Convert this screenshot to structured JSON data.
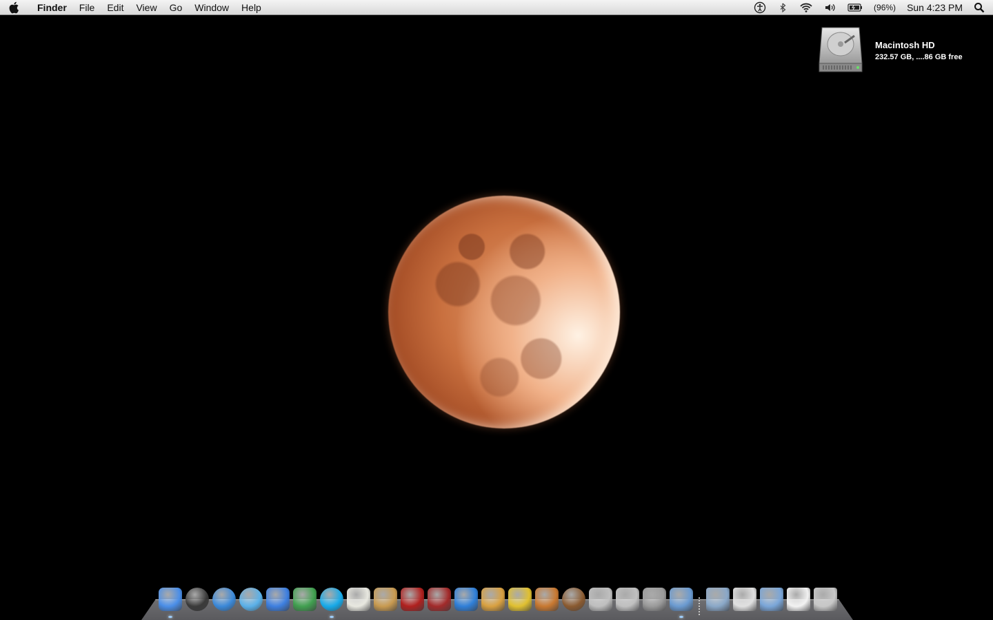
{
  "menubar": {
    "apple_icon": "apple-logo-icon",
    "app_name": "Finder",
    "menus": [
      "File",
      "Edit",
      "View",
      "Go",
      "Window",
      "Help"
    ],
    "status": {
      "accessibility_icon": "accessibility-icon",
      "bluetooth_icon": "bluetooth-icon",
      "wifi_icon": "wifi-icon",
      "volume_icon": "volume-icon",
      "battery_icon": "battery-icon",
      "battery_percent": "(96%)",
      "clock": "Sun 4:23 PM",
      "spotlight_icon": "spotlight-search-icon"
    }
  },
  "desktop": {
    "wallpaper": "lunar-eclipse-moon",
    "drive": {
      "name": "Macintosh HD",
      "info": "232.57 GB, ....86 GB free",
      "icon": "hard-drive-icon"
    }
  },
  "dock": {
    "apps": [
      {
        "name": "Finder",
        "icon": "finder-icon",
        "running": true,
        "color": "#4a8ee8"
      },
      {
        "name": "Dashboard",
        "icon": "dashboard-icon",
        "running": false,
        "color": "#3a3a3a"
      },
      {
        "name": "Safari",
        "icon": "safari-icon",
        "running": false,
        "color": "#3a88d8"
      },
      {
        "name": "iTunes",
        "icon": "itunes-icon",
        "running": false,
        "color": "#5ab0e8"
      },
      {
        "name": "iChat",
        "icon": "ichat-icon",
        "running": false,
        "color": "#3d7fe0"
      },
      {
        "name": "Messenger",
        "icon": "messenger-icon",
        "running": false,
        "color": "#41a050"
      },
      {
        "name": "Skype",
        "icon": "skype-icon",
        "running": true,
        "color": "#16a9e8"
      },
      {
        "name": "TextEdit",
        "icon": "textedit-icon",
        "running": false,
        "color": "#e8e8e0"
      },
      {
        "name": "Address Book",
        "icon": "address-book-icon",
        "running": false,
        "color": "#c89a50"
      },
      {
        "name": "Photo Booth",
        "icon": "photo-booth-icon",
        "running": false,
        "color": "#b0201e"
      },
      {
        "name": "Dictionary",
        "icon": "dictionary-icon",
        "running": false,
        "color": "#a22a2a"
      },
      {
        "name": "Word",
        "icon": "word-icon",
        "running": false,
        "color": "#2f7fd8"
      },
      {
        "name": "iPhoto",
        "icon": "iphoto-icon",
        "running": false,
        "color": "#d8a040"
      },
      {
        "name": "iMovie",
        "icon": "imovie-icon",
        "running": false,
        "color": "#e0c030"
      },
      {
        "name": "GarageBand",
        "icon": "garageband-icon",
        "running": false,
        "color": "#c87830"
      },
      {
        "name": "Coconut Battery",
        "icon": "coconut-icon",
        "running": false,
        "color": "#8a5a30"
      },
      {
        "name": "Image Capture",
        "icon": "image-capture-icon",
        "running": false,
        "color": "#bfbfbf"
      },
      {
        "name": "DVD Player",
        "icon": "dvd-player-icon",
        "running": false,
        "color": "#c0c0c0"
      },
      {
        "name": "System Preferences",
        "icon": "system-preferences-icon",
        "running": false,
        "color": "#9a9a9a"
      },
      {
        "name": "Preview",
        "icon": "preview-icon",
        "running": true,
        "color": "#6a9ad0"
      }
    ],
    "stacks": [
      {
        "name": "Screenshots",
        "icon": "camera-stack-icon",
        "color": "#8aa8c8"
      },
      {
        "name": "Documents",
        "icon": "pdf-stack-icon",
        "color": "#e0e0e0"
      },
      {
        "name": "Folder",
        "icon": "folder-stack-icon",
        "color": "#7aa6d8"
      },
      {
        "name": "Notes",
        "icon": "notes-stack-icon",
        "color": "#f2f2f2"
      },
      {
        "name": "Trash",
        "icon": "trash-icon",
        "color": "#c8c8c8"
      }
    ]
  }
}
